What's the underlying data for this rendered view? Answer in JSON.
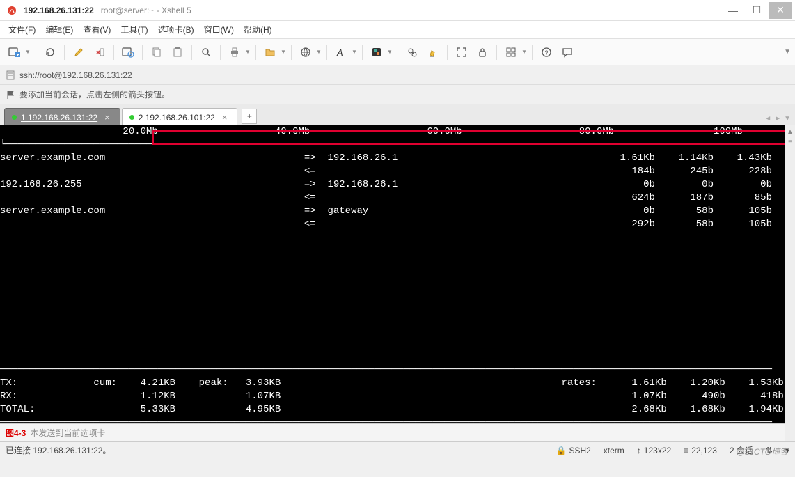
{
  "window": {
    "title_main": "192.168.26.131:22",
    "title_sub": "root@server:~ - Xshell 5"
  },
  "menu": {
    "file": "文件(F)",
    "edit": "编辑(E)",
    "view": "查看(V)",
    "tools": "工具(T)",
    "tabs": "选项卡(B)",
    "window": "窗口(W)",
    "help": "帮助(H)"
  },
  "addressbar": {
    "url": "ssh://root@192.168.26.131:22"
  },
  "hint": {
    "text": "要添加当前会话，点击左侧的箭头按钮。"
  },
  "tabs": [
    {
      "label": "1 192.168.26.131:22",
      "active": true
    },
    {
      "label": "2 192.168.26.101:22",
      "active": false
    }
  ],
  "terminal": {
    "scale": [
      "20.0Mb",
      "40.0Mb",
      "60.0Mb",
      "80.0Mb",
      "100Mb"
    ],
    "rows": [
      {
        "src": "server.example.com",
        "dir_out": "=>",
        "dst": "192.168.26.1",
        "r1": "1.61Kb",
        "r2": "1.14Kb",
        "r3": "1.43Kb"
      },
      {
        "src": "",
        "dir_out": "<=",
        "dst": "",
        "r1": "184b",
        "r2": "245b",
        "r3": "228b"
      },
      {
        "src": "192.168.26.255",
        "dir_out": "=>",
        "dst": "192.168.26.1",
        "r1": "0b",
        "r2": "0b",
        "r3": "0b"
      },
      {
        "src": "",
        "dir_out": "<=",
        "dst": "",
        "r1": "624b",
        "r2": "187b",
        "r3": "85b"
      },
      {
        "src": "server.example.com",
        "dir_out": "=>",
        "dst": "gateway",
        "r1": "0b",
        "r2": "58b",
        "r3": "105b"
      },
      {
        "src": "",
        "dir_out": "<=",
        "dst": "",
        "r1": "292b",
        "r2": "58b",
        "r3": "105b"
      }
    ],
    "summary": {
      "tx_label": "TX:",
      "cum_label": "cum:",
      "peak_label": "peak:",
      "rates_label": "rates:",
      "rx_label": "RX:",
      "total_label": "TOTAL:",
      "tx_cum": "4.21KB",
      "tx_peak": "3.93KB",
      "tx_r1": "1.61Kb",
      "tx_r2": "1.20Kb",
      "tx_r3": "1.53Kb",
      "rx_cum": "1.12KB",
      "rx_peak": "1.07KB",
      "rx_r1": "1.07Kb",
      "rx_r2": "490b",
      "rx_r3": "418b",
      "tot_cum": "5.33KB",
      "tot_peak": "4.95KB",
      "tot_r1": "2.68Kb",
      "tot_r2": "1.68Kb",
      "tot_r3": "1.94Kb"
    }
  },
  "sendbar": {
    "figure": "图4-3",
    "placeholder": "本发送到当前选项卡"
  },
  "status": {
    "connected": "已连接 192.168.26.131:22。",
    "proto": "SSH2",
    "term": "xterm",
    "size": "123x22",
    "bytes": "22,123",
    "sessions": "2 会话"
  },
  "watermark": "@51CTO博客"
}
